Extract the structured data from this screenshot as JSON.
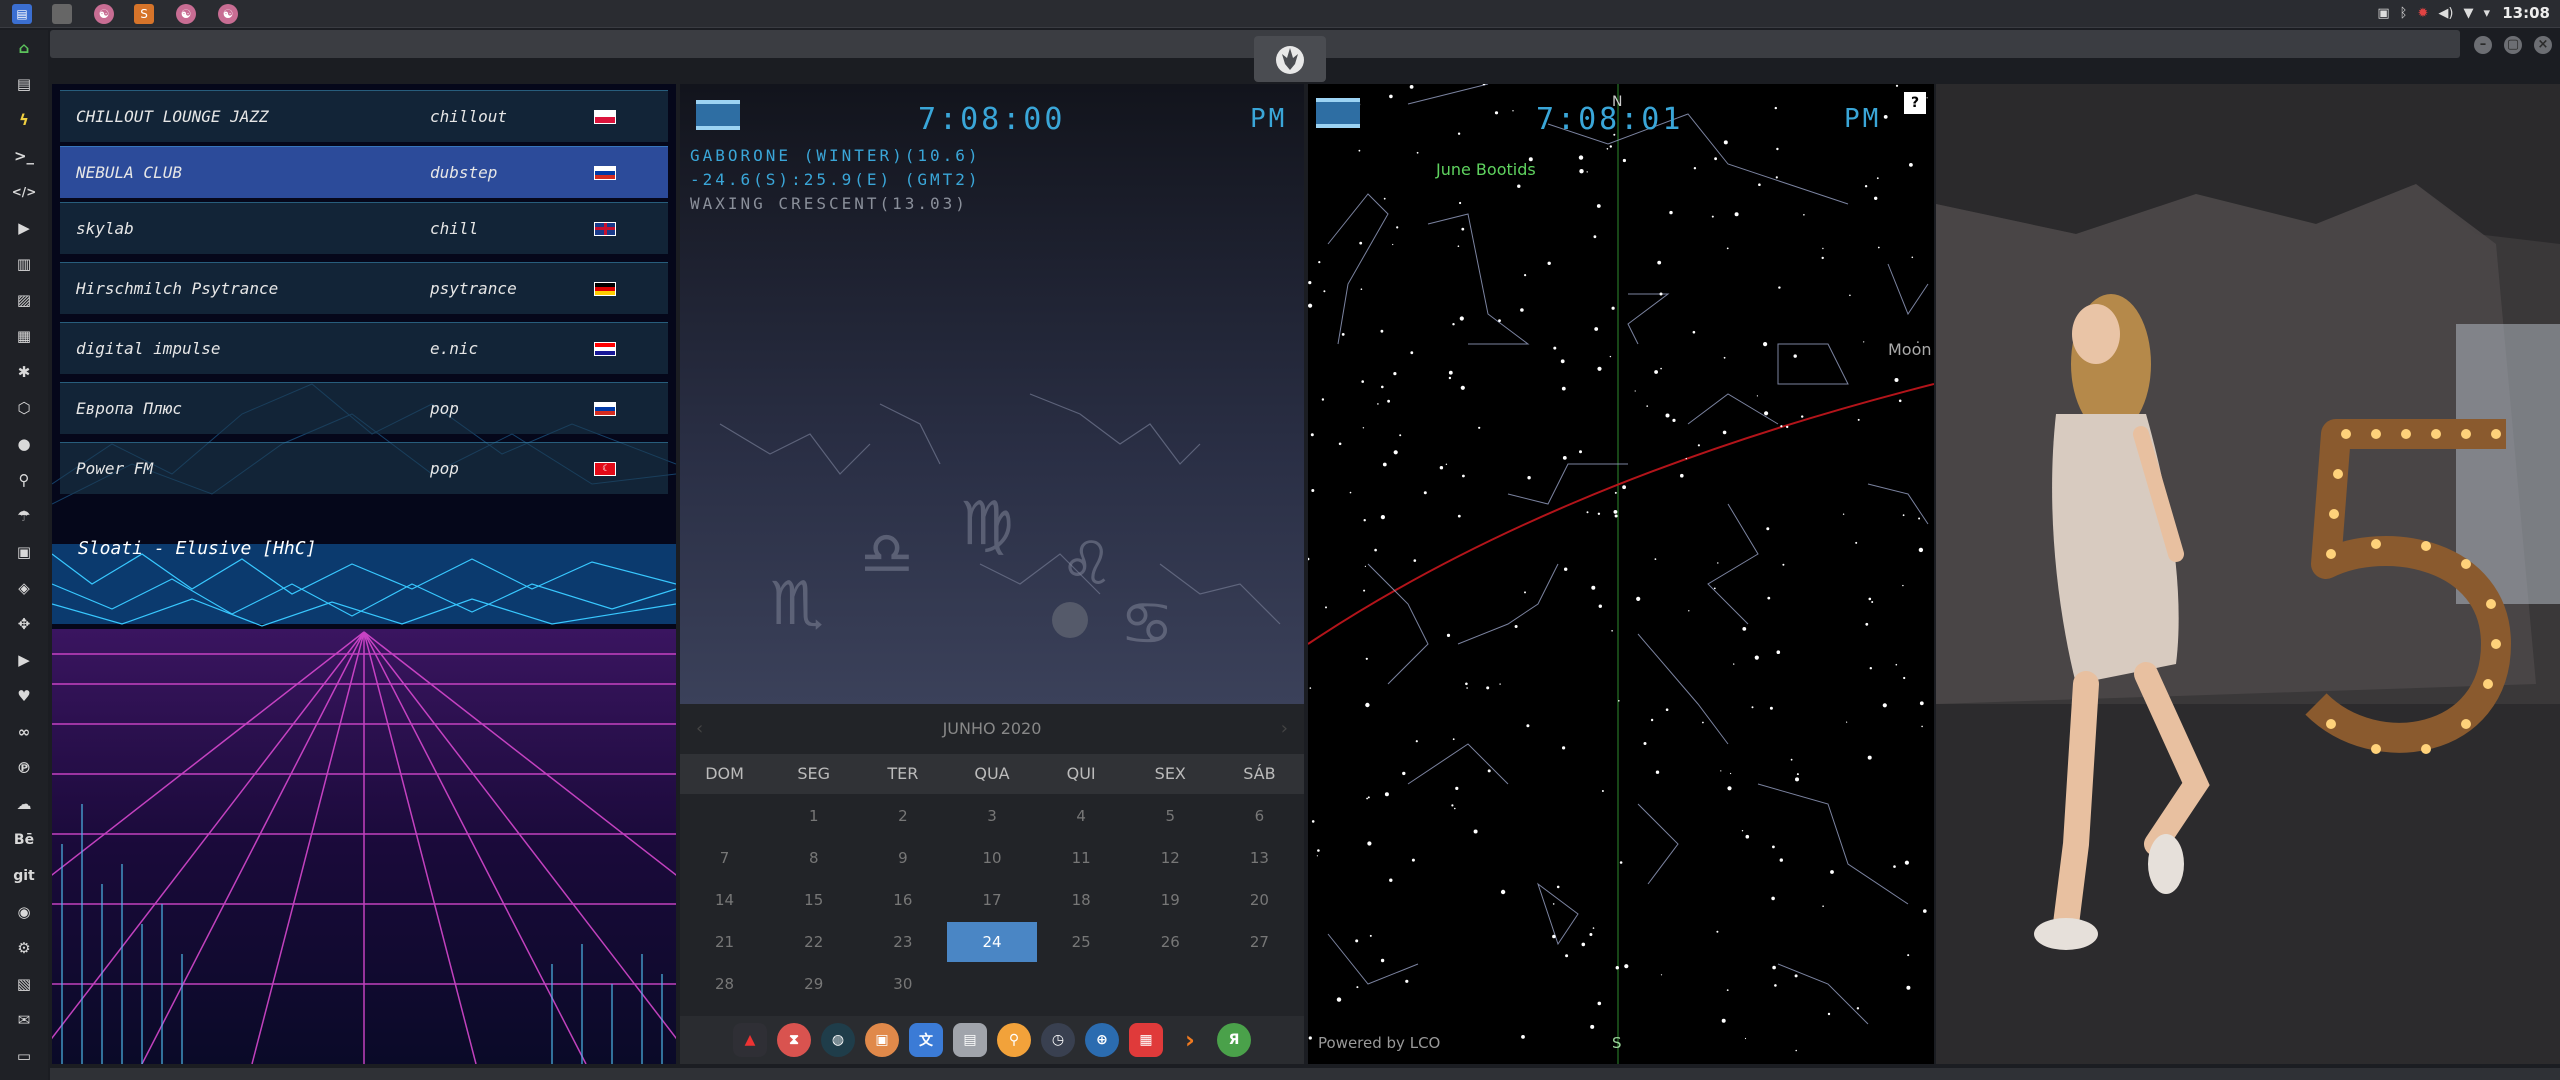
{
  "topbar": {
    "time": "13:08",
    "app_icons": [
      "files-icon",
      "app-icon",
      "app-icon",
      "sublime-icon",
      "app-icon",
      "app-icon"
    ],
    "tray_icons": [
      "image-icon",
      "bluetooth-icon",
      "bug-icon",
      "volume-icon",
      "wifi-icon",
      "dropdown-icon"
    ]
  },
  "window": {
    "buttons": [
      "–",
      "▢",
      "×"
    ]
  },
  "sidebar": {
    "items": [
      "home",
      "document",
      "lightning",
      "terminal",
      "code",
      "play",
      "files",
      "image",
      "news",
      "gear",
      "hexagon",
      "globe",
      "search",
      "umbrella",
      "contact",
      "tag",
      "expand",
      "youtube",
      "heart",
      "lastfm",
      "pinterest",
      "cloud",
      "behance",
      "git",
      "github",
      "bicycle",
      "map",
      "mail",
      "slideshare"
    ],
    "labels": {
      "behance": "Bē",
      "git": "git"
    }
  },
  "radio": {
    "stations": [
      {
        "name": "CHILLOUT LOUNGE JAZZ",
        "genre": "chillout",
        "flag": "pl",
        "active": false
      },
      {
        "name": "NEBULA CLUB",
        "genre": "dubstep",
        "flag": "ru",
        "active": true
      },
      {
        "name": "skylab",
        "genre": "chill",
        "flag": "gb",
        "active": false
      },
      {
        "name": "Hirschmilch Psytrance",
        "genre": "psytrance",
        "flag": "de",
        "active": false
      },
      {
        "name": "digital impulse",
        "genre": "e.nic",
        "flag": "hr",
        "active": false
      },
      {
        "name": "Европа Плюс",
        "genre": "pop",
        "flag": "ru",
        "active": false
      },
      {
        "name": "Power FM",
        "genre": "pop",
        "flag": "tr",
        "active": false
      }
    ],
    "now_playing": "Sloati - Elusive [HhC]"
  },
  "clock": {
    "time": "7:08:00",
    "ampm": "PM",
    "location_line": "GABORONE (WINTER)(10.6)",
    "coords_line": "-24.6(S):25.9(E) (GMT2)",
    "moon_line": "WAXING CRESCENT(13.03)"
  },
  "calendar": {
    "month": "JUNHO 2020",
    "weekdays": [
      "DOM",
      "SEG",
      "TER",
      "QUA",
      "QUI",
      "SEX",
      "SÁB"
    ],
    "weeks": [
      [
        "",
        "1",
        "2",
        "3",
        "4",
        "5",
        "6"
      ],
      [
        "7",
        "8",
        "9",
        "10",
        "11",
        "12",
        "13"
      ],
      [
        "14",
        "15",
        "16",
        "17",
        "18",
        "19",
        "20"
      ],
      [
        "21",
        "22",
        "23",
        "24",
        "25",
        "26",
        "27"
      ],
      [
        "28",
        "29",
        "30",
        "",
        "",
        "",
        ""
      ]
    ],
    "today": "24"
  },
  "dock": {
    "items": [
      "app-icon",
      "hourglass-icon",
      "globe-icon",
      "photos-icon",
      "translate-icon",
      "notes-icon",
      "search-icon",
      "clock-icon",
      "browser-icon",
      "calendar-icon",
      "arrow-icon",
      "yandex-icon"
    ]
  },
  "sky": {
    "time": "7:08:01",
    "ampm": "PM",
    "north": "N",
    "south": "S",
    "help": "?",
    "meteor_label": "June Bootids",
    "moon_label": "Moon",
    "credit": "Powered by LCO"
  },
  "colors": {
    "accent_blue": "#3aa6d8",
    "active_station": "#2c4b9a",
    "today": "#4a86c5",
    "ecliptic": "#b3141a",
    "meridian": "#2e8b2e",
    "meteor": "#5fd35f"
  }
}
